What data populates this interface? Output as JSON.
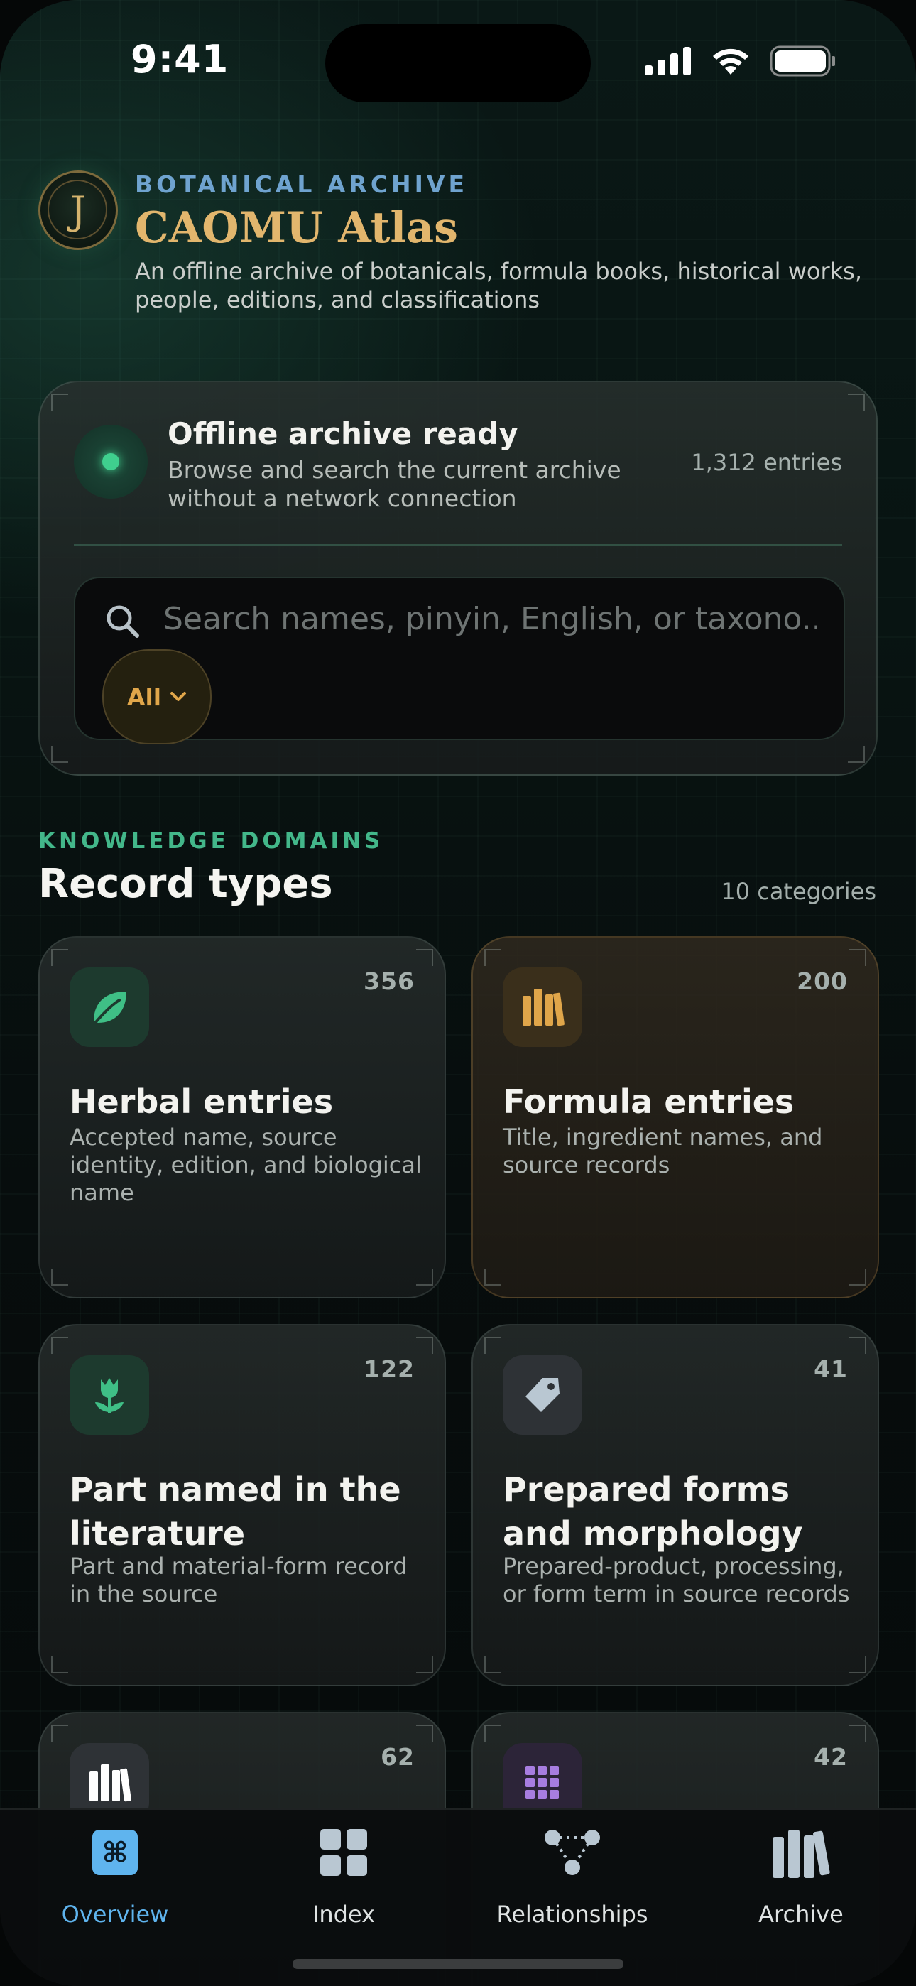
{
  "status_bar": {
    "time": "9:41"
  },
  "header": {
    "logo_glyph": "J",
    "eyebrow": "BOTANICAL ARCHIVE",
    "title": "CAOMU Atlas",
    "subtitle": "An offline archive of botanicals, formula books, historical works, people, editions, and classifications"
  },
  "archive_card": {
    "status_title": "Offline archive ready",
    "status_subtitle": "Browse and search the current archive without a network connection",
    "entry_count": "1,312 entries",
    "search_placeholder": "Search names, pinyin, English, or taxono...",
    "filter_label": "All"
  },
  "section": {
    "eyebrow": "KNOWLEDGE DOMAINS",
    "title": "Record types",
    "count": "10 categories"
  },
  "record_types": [
    {
      "title": "Herbal entries",
      "description": "Accepted name, source identity, edition, and biological name",
      "count": "356",
      "icon": "leaf-icon",
      "color": "#3fbf86"
    },
    {
      "title": "Formula entries",
      "description": "Title, ingredient names, and source records",
      "count": "200",
      "icon": "books-icon",
      "color": "#e0a64a"
    },
    {
      "title": "Part named in the literature",
      "description": "Part and material-form record in the source",
      "count": "122",
      "icon": "tulip-icon",
      "color": "#3fbf86"
    },
    {
      "title": "Prepared forms and morphology",
      "description": "Prepared-product, processing, or form term in source records",
      "count": "41",
      "icon": "tag-icon",
      "color": "#b9c7d2"
    },
    {
      "title": "",
      "description": "",
      "count": "62",
      "icon": "books-icon",
      "color": "#ffffff"
    },
    {
      "title": "",
      "description": "",
      "count": "42",
      "icon": "grid-icon",
      "color": "#a77de0"
    }
  ],
  "tab_bar": {
    "tabs": [
      {
        "label": "Overview",
        "icon": "command-icon",
        "active": true
      },
      {
        "label": "Index",
        "icon": "grid-icon",
        "active": false
      },
      {
        "label": "Relationships",
        "icon": "graph-icon",
        "active": false
      },
      {
        "label": "Archive",
        "icon": "books-icon",
        "active": false
      }
    ],
    "accent": "#5fb4ee"
  }
}
